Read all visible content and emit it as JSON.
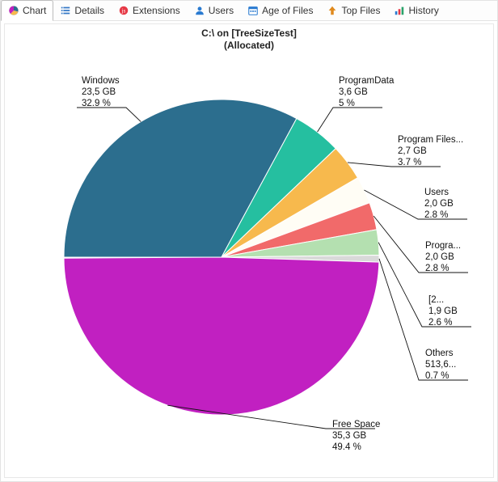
{
  "tabs": [
    {
      "id": "chart",
      "label": "Chart",
      "active": true
    },
    {
      "id": "details",
      "label": "Details"
    },
    {
      "id": "extensions",
      "label": "Extensions"
    },
    {
      "id": "users",
      "label": "Users"
    },
    {
      "id": "age",
      "label": "Age of Files"
    },
    {
      "id": "top",
      "label": "Top Files"
    },
    {
      "id": "history",
      "label": "History"
    }
  ],
  "chart": {
    "title_line1": "C:\\ on [TreeSizeTest]",
    "title_line2": "(Allocated)"
  },
  "chart_data": {
    "type": "pie",
    "title": "C:\\ on [TreeSizeTest] (Allocated)",
    "series": [
      {
        "name": "Free Space",
        "size": "35,3 GB",
        "size_gb": 35.3,
        "percent": 49.4,
        "color": "#c120c1"
      },
      {
        "name": "Windows",
        "size": "23,5 GB",
        "size_gb": 23.5,
        "percent": 32.9,
        "color": "#2c6e8e"
      },
      {
        "name": "ProgramData",
        "size": "3,6 GB",
        "size_gb": 3.6,
        "percent": 5.0,
        "color": "#25bfa0"
      },
      {
        "name": "Program Files...",
        "size": "2,7 GB",
        "size_gb": 2.7,
        "percent": 3.7,
        "color": "#f7b94d"
      },
      {
        "name": "Users",
        "size": "2,0 GB",
        "size_gb": 2.0,
        "percent": 2.8,
        "color": "#fffdf5"
      },
      {
        "name": "Progra...",
        "size": "2,0 GB",
        "size_gb": 2.0,
        "percent": 2.8,
        "color": "#f16a6a"
      },
      {
        "name": "[2...",
        "size": "1,9 GB",
        "size_gb": 1.9,
        "percent": 2.6,
        "color": "#b4e0b0"
      },
      {
        "name": "Others",
        "size": "513,6...",
        "size_gb": 0.5,
        "percent": 0.7,
        "color": "#d9d9d9"
      }
    ]
  }
}
